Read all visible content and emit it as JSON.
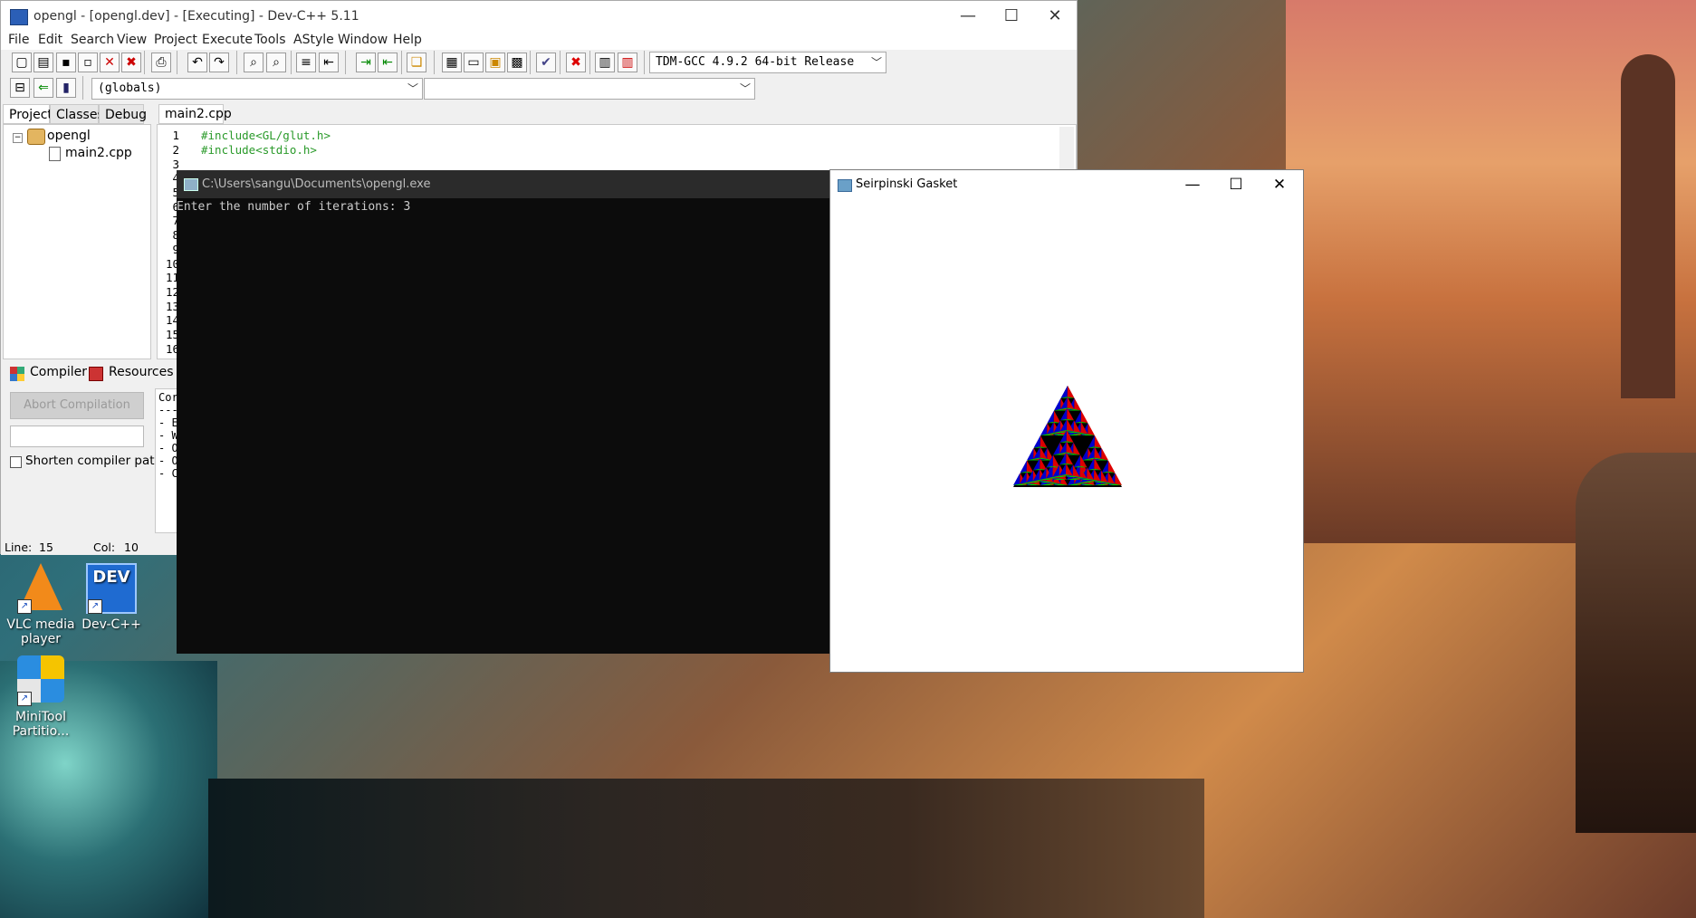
{
  "desktop": {
    "icons": [
      {
        "label_line1": "VLC media",
        "label_line2": "player"
      },
      {
        "label_line1": "Dev-C++",
        "label_line2": "",
        "badge": "DEV"
      },
      {
        "label_line1": "MiniTool",
        "label_line2": "Partitio..."
      }
    ]
  },
  "devcpp": {
    "title": "opengl - [opengl.dev] - [Executing] - Dev-C++ 5.11",
    "menu": [
      "File",
      "Edit",
      "Search",
      "View",
      "Project",
      "Execute",
      "Tools",
      "AStyle",
      "Window",
      "Help"
    ],
    "compiler_select": "TDM-GCC 4.9.2 64-bit Release",
    "scope_select": "(globals)",
    "left_tabs": [
      "Project",
      "Classes",
      "Debug"
    ],
    "project_tree": {
      "project": "opengl",
      "file": "main2.cpp"
    },
    "editor_tab": "main2.cpp",
    "line_numbers": [
      "1",
      "2",
      "3",
      "4",
      "5",
      "6",
      "7",
      "8",
      "9",
      "10",
      "11",
      "12",
      "13",
      "14",
      "15",
      "16"
    ],
    "code_lines": [
      "#include<GL/glut.h>",
      "#include<stdio.h>"
    ],
    "bottom_tabs": {
      "compiler": "Compiler",
      "resources": "Resources"
    },
    "abort_button": "Abort Compilation",
    "shorten_paths_label": "Shorten compiler paths",
    "log_lines": [
      "Cor",
      "---",
      "- E",
      "- W",
      "- O",
      "- O",
      "- C"
    ],
    "status": {
      "line_label": "Line:",
      "line_value": "15",
      "col_label": "Col:",
      "col_value": "10"
    }
  },
  "console": {
    "title": "C:\\Users\\sangu\\Documents\\opengl.exe",
    "output": "Enter the number of iterations: 3"
  },
  "gasket_window": {
    "title": "Seirpinski Gasket",
    "colors": {
      "face_left": "#0000cc",
      "face_right": "#dd0000",
      "face_bottom": "#00cc00",
      "hole": "#000000"
    }
  },
  "window_controls": {
    "minimize": "—",
    "maximize": "☐",
    "close": "✕"
  }
}
